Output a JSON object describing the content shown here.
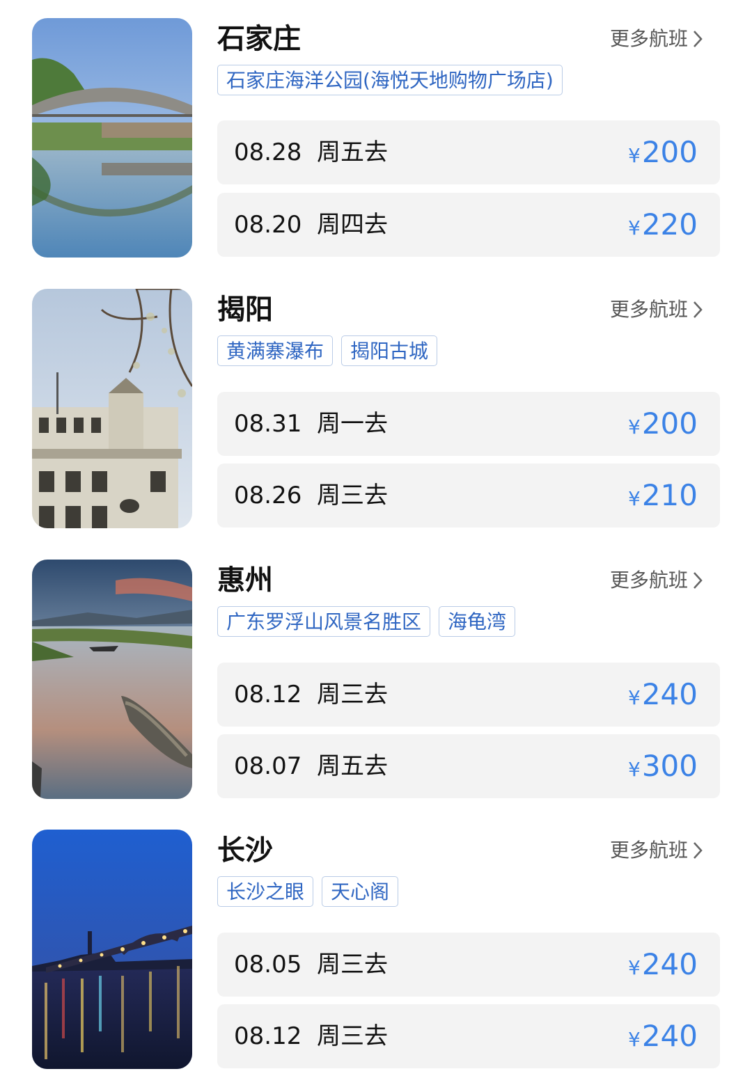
{
  "accent_color": "#3b82e6",
  "tag_color": "#2f66c2",
  "destinations": [
    {
      "city": "石家庄",
      "more_label": "更多航班",
      "image": "stone-arch-bridge-photo",
      "tags": [
        "石家庄海洋公园(海悦天地购物广场店)"
      ],
      "flights": [
        {
          "date": "08.28",
          "weekday": "周五去",
          "currency": "¥",
          "price": "200"
        },
        {
          "date": "08.20",
          "weekday": "周四去",
          "currency": "¥",
          "price": "220"
        }
      ]
    },
    {
      "city": "揭阳",
      "more_label": "更多航班",
      "image": "old-building-photo",
      "tags": [
        "黄满寨瀑布",
        "揭阳古城"
      ],
      "flights": [
        {
          "date": "08.31",
          "weekday": "周一去",
          "currency": "¥",
          "price": "200"
        },
        {
          "date": "08.26",
          "weekday": "周三去",
          "currency": "¥",
          "price": "210"
        }
      ]
    },
    {
      "city": "惠州",
      "more_label": "更多航班",
      "image": "lake-boats-photo",
      "tags": [
        "广东罗浮山风景名胜区",
        "海龟湾"
      ],
      "flights": [
        {
          "date": "08.12",
          "weekday": "周三去",
          "currency": "¥",
          "price": "240"
        },
        {
          "date": "08.07",
          "weekday": "周五去",
          "currency": "¥",
          "price": "300"
        }
      ]
    },
    {
      "city": "长沙",
      "more_label": "更多航班",
      "image": "night-bridge-photo",
      "tags": [
        "长沙之眼",
        "天心阁"
      ],
      "flights": [
        {
          "date": "08.05",
          "weekday": "周三去",
          "currency": "¥",
          "price": "240"
        },
        {
          "date": "08.12",
          "weekday": "周三去",
          "currency": "¥",
          "price": "240"
        }
      ]
    }
  ]
}
